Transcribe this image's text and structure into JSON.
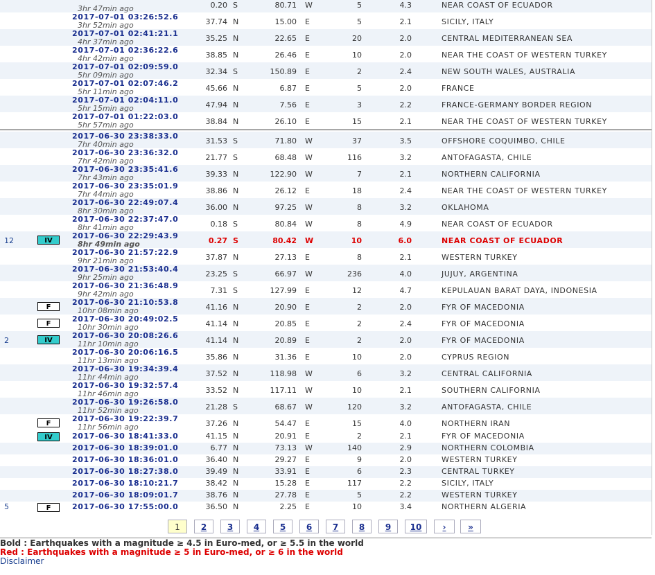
{
  "top_rows": [
    {
      "dt": "",
      "ago": "3hr 47min ago",
      "lat": "0.20",
      "ns": "S",
      "lon": "80.71",
      "ew": "W",
      "depth": "5",
      "mag": "4.3",
      "region": "NEAR COAST OF ECUADOR"
    },
    {
      "dt": "2017-07-01  03:26:52.6",
      "ago": "3hr 52min ago",
      "lat": "37.74",
      "ns": "N",
      "lon": "15.00",
      "ew": "E",
      "depth": "5",
      "mag": "2.1",
      "region": "SICILY, ITALY"
    },
    {
      "dt": "2017-07-01  02:41:21.1",
      "ago": "4hr 37min ago",
      "lat": "35.25",
      "ns": "N",
      "lon": "22.65",
      "ew": "E",
      "depth": "20",
      "mag": "2.0",
      "region": "CENTRAL MEDITERRANEAN SEA"
    },
    {
      "dt": "2017-07-01  02:36:22.6",
      "ago": "4hr 42min ago",
      "lat": "38.85",
      "ns": "N",
      "lon": "26.46",
      "ew": "E",
      "depth": "10",
      "mag": "2.0",
      "region": "NEAR THE COAST OF WESTERN TURKEY"
    },
    {
      "dt": "2017-07-01  02:09:59.0",
      "ago": "5hr 09min ago",
      "lat": "32.34",
      "ns": "S",
      "lon": "150.89",
      "ew": "E",
      "depth": "2",
      "mag": "2.4",
      "region": "NEW SOUTH WALES, AUSTRALIA"
    },
    {
      "dt": "2017-07-01  02:07:46.2",
      "ago": "5hr 11min ago",
      "lat": "45.66",
      "ns": "N",
      "lon": "6.87",
      "ew": "E",
      "depth": "5",
      "mag": "2.0",
      "region": "FRANCE"
    },
    {
      "dt": "2017-07-01  02:04:11.0",
      "ago": "5hr 15min ago",
      "lat": "47.94",
      "ns": "N",
      "lon": "7.56",
      "ew": "E",
      "depth": "3",
      "mag": "2.2",
      "region": "FRANCE-GERMANY BORDER REGION"
    },
    {
      "dt": "2017-07-01  01:22:03.0",
      "ago": "5hr 57min ago",
      "lat": "38.84",
      "ns": "N",
      "lon": "26.10",
      "ew": "E",
      "depth": "15",
      "mag": "2.1",
      "region": "NEAR THE COAST OF WESTERN TURKEY"
    }
  ],
  "bottom_rows": [
    {
      "felt": "",
      "badge": "",
      "dt": "2017-06-30  23:38:33.0",
      "ago": "7hr 40min ago",
      "lat": "31.53",
      "ns": "S",
      "lon": "71.80",
      "ew": "W",
      "depth": "37",
      "mag": "3.5",
      "region": "OFFSHORE COQUIMBO, CHILE"
    },
    {
      "felt": "",
      "badge": "",
      "dt": "2017-06-30  23:36:32.0",
      "ago": "7hr 42min ago",
      "lat": "21.77",
      "ns": "S",
      "lon": "68.48",
      "ew": "W",
      "depth": "116",
      "mag": "3.2",
      "region": "ANTOFAGASTA, CHILE"
    },
    {
      "felt": "",
      "badge": "",
      "dt": "2017-06-30  23:35:41.6",
      "ago": "7hr 43min ago",
      "lat": "39.33",
      "ns": "N",
      "lon": "122.90",
      "ew": "W",
      "depth": "7",
      "mag": "2.1",
      "region": "NORTHERN CALIFORNIA"
    },
    {
      "felt": "",
      "badge": "",
      "dt": "2017-06-30  23:35:01.9",
      "ago": "7hr 44min ago",
      "lat": "38.86",
      "ns": "N",
      "lon": "26.12",
      "ew": "E",
      "depth": "18",
      "mag": "2.4",
      "region": "NEAR THE COAST OF WESTERN TURKEY"
    },
    {
      "felt": "",
      "badge": "",
      "dt": "2017-06-30  22:49:07.4",
      "ago": "8hr 30min ago",
      "lat": "36.00",
      "ns": "N",
      "lon": "97.25",
      "ew": "W",
      "depth": "8",
      "mag": "3.2",
      "region": "OKLAHOMA"
    },
    {
      "felt": "",
      "badge": "",
      "dt": "2017-06-30  22:37:47.0",
      "ago": "8hr 41min ago",
      "lat": "0.18",
      "ns": "S",
      "lon": "80.84",
      "ew": "W",
      "depth": "8",
      "mag": "4.9",
      "region": "NEAR COAST OF ECUADOR"
    },
    {
      "felt": "12",
      "badge": "IV",
      "dt": "2017-06-30  22:29:43.9",
      "ago": "8hr 49min ago",
      "lat": "0.27",
      "ns": "S",
      "lon": "80.42",
      "ew": "W",
      "depth": "10",
      "mag": "6.0",
      "region": "NEAR COAST OF ECUADOR",
      "red": true
    },
    {
      "felt": "",
      "badge": "",
      "dt": "2017-06-30  21:57:22.9",
      "ago": "9hr 21min ago",
      "lat": "37.87",
      "ns": "N",
      "lon": "27.13",
      "ew": "E",
      "depth": "8",
      "mag": "2.1",
      "region": "WESTERN TURKEY"
    },
    {
      "felt": "",
      "badge": "",
      "dt": "2017-06-30  21:53:40.4",
      "ago": "9hr 25min ago",
      "lat": "23.25",
      "ns": "S",
      "lon": "66.97",
      "ew": "W",
      "depth": "236",
      "mag": "4.0",
      "region": "JUJUY, ARGENTINA"
    },
    {
      "felt": "",
      "badge": "",
      "dt": "2017-06-30  21:36:48.9",
      "ago": "9hr 42min ago",
      "lat": "7.31",
      "ns": "S",
      "lon": "127.99",
      "ew": "E",
      "depth": "12",
      "mag": "4.7",
      "region": "KEPULAUAN BARAT DAYA, INDONESIA"
    },
    {
      "felt": "",
      "badge": "F",
      "dt": "2017-06-30  21:10:53.8",
      "ago": "10hr 08min ago",
      "lat": "41.16",
      "ns": "N",
      "lon": "20.90",
      "ew": "E",
      "depth": "2",
      "mag": "2.0",
      "region": "FYR OF MACEDONIA"
    },
    {
      "felt": "",
      "badge": "F",
      "dt": "2017-06-30  20:49:02.5",
      "ago": "10hr 30min ago",
      "lat": "41.14",
      "ns": "N",
      "lon": "20.85",
      "ew": "E",
      "depth": "2",
      "mag": "2.4",
      "region": "FYR OF MACEDONIA"
    },
    {
      "felt": "2",
      "badge": "IV",
      "dt": "2017-06-30  20:08:26.6",
      "ago": "11hr 10min ago",
      "lat": "41.14",
      "ns": "N",
      "lon": "20.89",
      "ew": "E",
      "depth": "2",
      "mag": "2.0",
      "region": "FYR OF MACEDONIA"
    },
    {
      "felt": "",
      "badge": "",
      "dt": "2017-06-30  20:06:16.5",
      "ago": "11hr 13min ago",
      "lat": "35.86",
      "ns": "N",
      "lon": "31.36",
      "ew": "E",
      "depth": "10",
      "mag": "2.0",
      "region": "CYPRUS REGION"
    },
    {
      "felt": "",
      "badge": "",
      "dt": "2017-06-30  19:34:39.4",
      "ago": "11hr 44min ago",
      "lat": "37.52",
      "ns": "N",
      "lon": "118.98",
      "ew": "W",
      "depth": "6",
      "mag": "3.2",
      "region": "CENTRAL CALIFORNIA"
    },
    {
      "felt": "",
      "badge": "",
      "dt": "2017-06-30  19:32:57.4",
      "ago": "11hr 46min ago",
      "lat": "33.52",
      "ns": "N",
      "lon": "117.11",
      "ew": "W",
      "depth": "10",
      "mag": "2.1",
      "region": "SOUTHERN CALIFORNIA"
    },
    {
      "felt": "",
      "badge": "",
      "dt": "2017-06-30  19:26:58.0",
      "ago": "11hr 52min ago",
      "lat": "21.28",
      "ns": "S",
      "lon": "68.67",
      "ew": "W",
      "depth": "120",
      "mag": "3.2",
      "region": "ANTOFAGASTA, CHILE"
    },
    {
      "felt": "",
      "badge": "F",
      "dt": "2017-06-30  19:22:39.7",
      "ago": "11hr 56min ago",
      "lat": "37.26",
      "ns": "N",
      "lon": "54.47",
      "ew": "E",
      "depth": "15",
      "mag": "4.0",
      "region": "NORTHERN IRAN"
    }
  ],
  "compact_rows": [
    {
      "felt": "",
      "badge": "IV",
      "dt": "2017-06-30  18:41:33.0",
      "lat": "41.15",
      "ns": "N",
      "lon": "20.91",
      "ew": "E",
      "depth": "2",
      "mag": "2.1",
      "region": "FYR OF MACEDONIA"
    },
    {
      "felt": "",
      "badge": "",
      "dt": "2017-06-30  18:39:01.0",
      "lat": "6.77",
      "ns": "N",
      "lon": "73.13",
      "ew": "W",
      "depth": "140",
      "mag": "2.9",
      "region": "NORTHERN COLOMBIA"
    },
    {
      "felt": "",
      "badge": "",
      "dt": "2017-06-30  18:36:01.0",
      "lat": "36.40",
      "ns": "N",
      "lon": "29.27",
      "ew": "E",
      "depth": "9",
      "mag": "2.0",
      "region": "WESTERN TURKEY"
    },
    {
      "felt": "",
      "badge": "",
      "dt": "2017-06-30  18:27:38.0",
      "lat": "39.49",
      "ns": "N",
      "lon": "33.91",
      "ew": "E",
      "depth": "6",
      "mag": "2.3",
      "region": "CENTRAL TURKEY"
    },
    {
      "felt": "",
      "badge": "",
      "dt": "2017-06-30  18:10:21.7",
      "lat": "38.42",
      "ns": "N",
      "lon": "15.28",
      "ew": "E",
      "depth": "117",
      "mag": "2.2",
      "region": "SICILY, ITALY"
    },
    {
      "felt": "",
      "badge": "",
      "dt": "2017-06-30  18:09:01.7",
      "lat": "38.76",
      "ns": "N",
      "lon": "27.78",
      "ew": "E",
      "depth": "5",
      "mag": "2.2",
      "region": "WESTERN TURKEY"
    },
    {
      "felt": "5",
      "badge": "F",
      "dt": "2017-06-30  17:55:00.0",
      "lat": "36.50",
      "ns": "N",
      "lon": "2.25",
      "ew": "E",
      "depth": "10",
      "mag": "3.4",
      "region": "NORTHERN ALGERIA"
    }
  ],
  "pagination": {
    "pages": [
      "1",
      "2",
      "3",
      "4",
      "5",
      "6",
      "7",
      "8",
      "9",
      "10"
    ],
    "active": "1",
    "next": "›",
    "last": "»"
  },
  "legend": {
    "bold": "Bold : Earthquakes with a magnitude ≥ 4.5 in Euro-med, or ≥ 5.5 in the world",
    "red": "Red : Earthquakes with a magnitude ≥ 5 in Euro-med, or ≥ 6 in the world"
  },
  "disclaimer": "Disclaimer"
}
